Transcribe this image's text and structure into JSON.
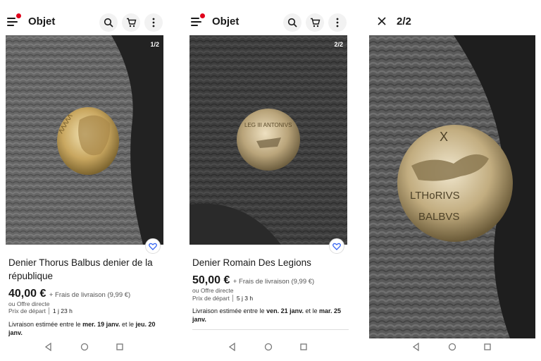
{
  "screens": [
    {
      "title": "Objet",
      "counter": "1/2",
      "product_title": "Denier Thorus Balbus denier de la république",
      "price": "40,00 €",
      "shipping": "+ Frais de livraison (9,99 €)",
      "offer": "ou Offre directe",
      "start_label": "Prix de départ",
      "time_left": "1 j 23 h",
      "delivery_prefix": "Livraison estimée entre le",
      "delivery_date1": "mer. 19 janv.",
      "delivery_mid": "et le",
      "delivery_date2": "jeu. 20 janv."
    },
    {
      "title": "Objet",
      "counter": "2/2",
      "product_title": "Denier Romain Des Legions",
      "price": "50,00 €",
      "shipping": "+ Frais de livraison (9,99 €)",
      "offer": "ou Offre directe",
      "start_label": "Prix de départ",
      "time_left": "5 j 3 h",
      "delivery_prefix": "Livraison estimée entre le",
      "delivery_date1": "ven. 21 janv.",
      "delivery_mid": "et le",
      "delivery_date2": "mar. 25 janv."
    },
    {
      "counter": "2/2"
    }
  ],
  "coin_legends": {
    "obverse": "ΛΛΛΛΛ",
    "legion": "LEG III ANTONIVS",
    "balbus_top": "LTHoRIVS",
    "balbus_bottom": "BALBVS",
    "balbus_x": "X"
  },
  "colors": {
    "accent_red": "#e0001b",
    "link_blue": "#3665f3",
    "fur_dark": "#2b2b2b",
    "fur_light": "#6f6f6f"
  }
}
